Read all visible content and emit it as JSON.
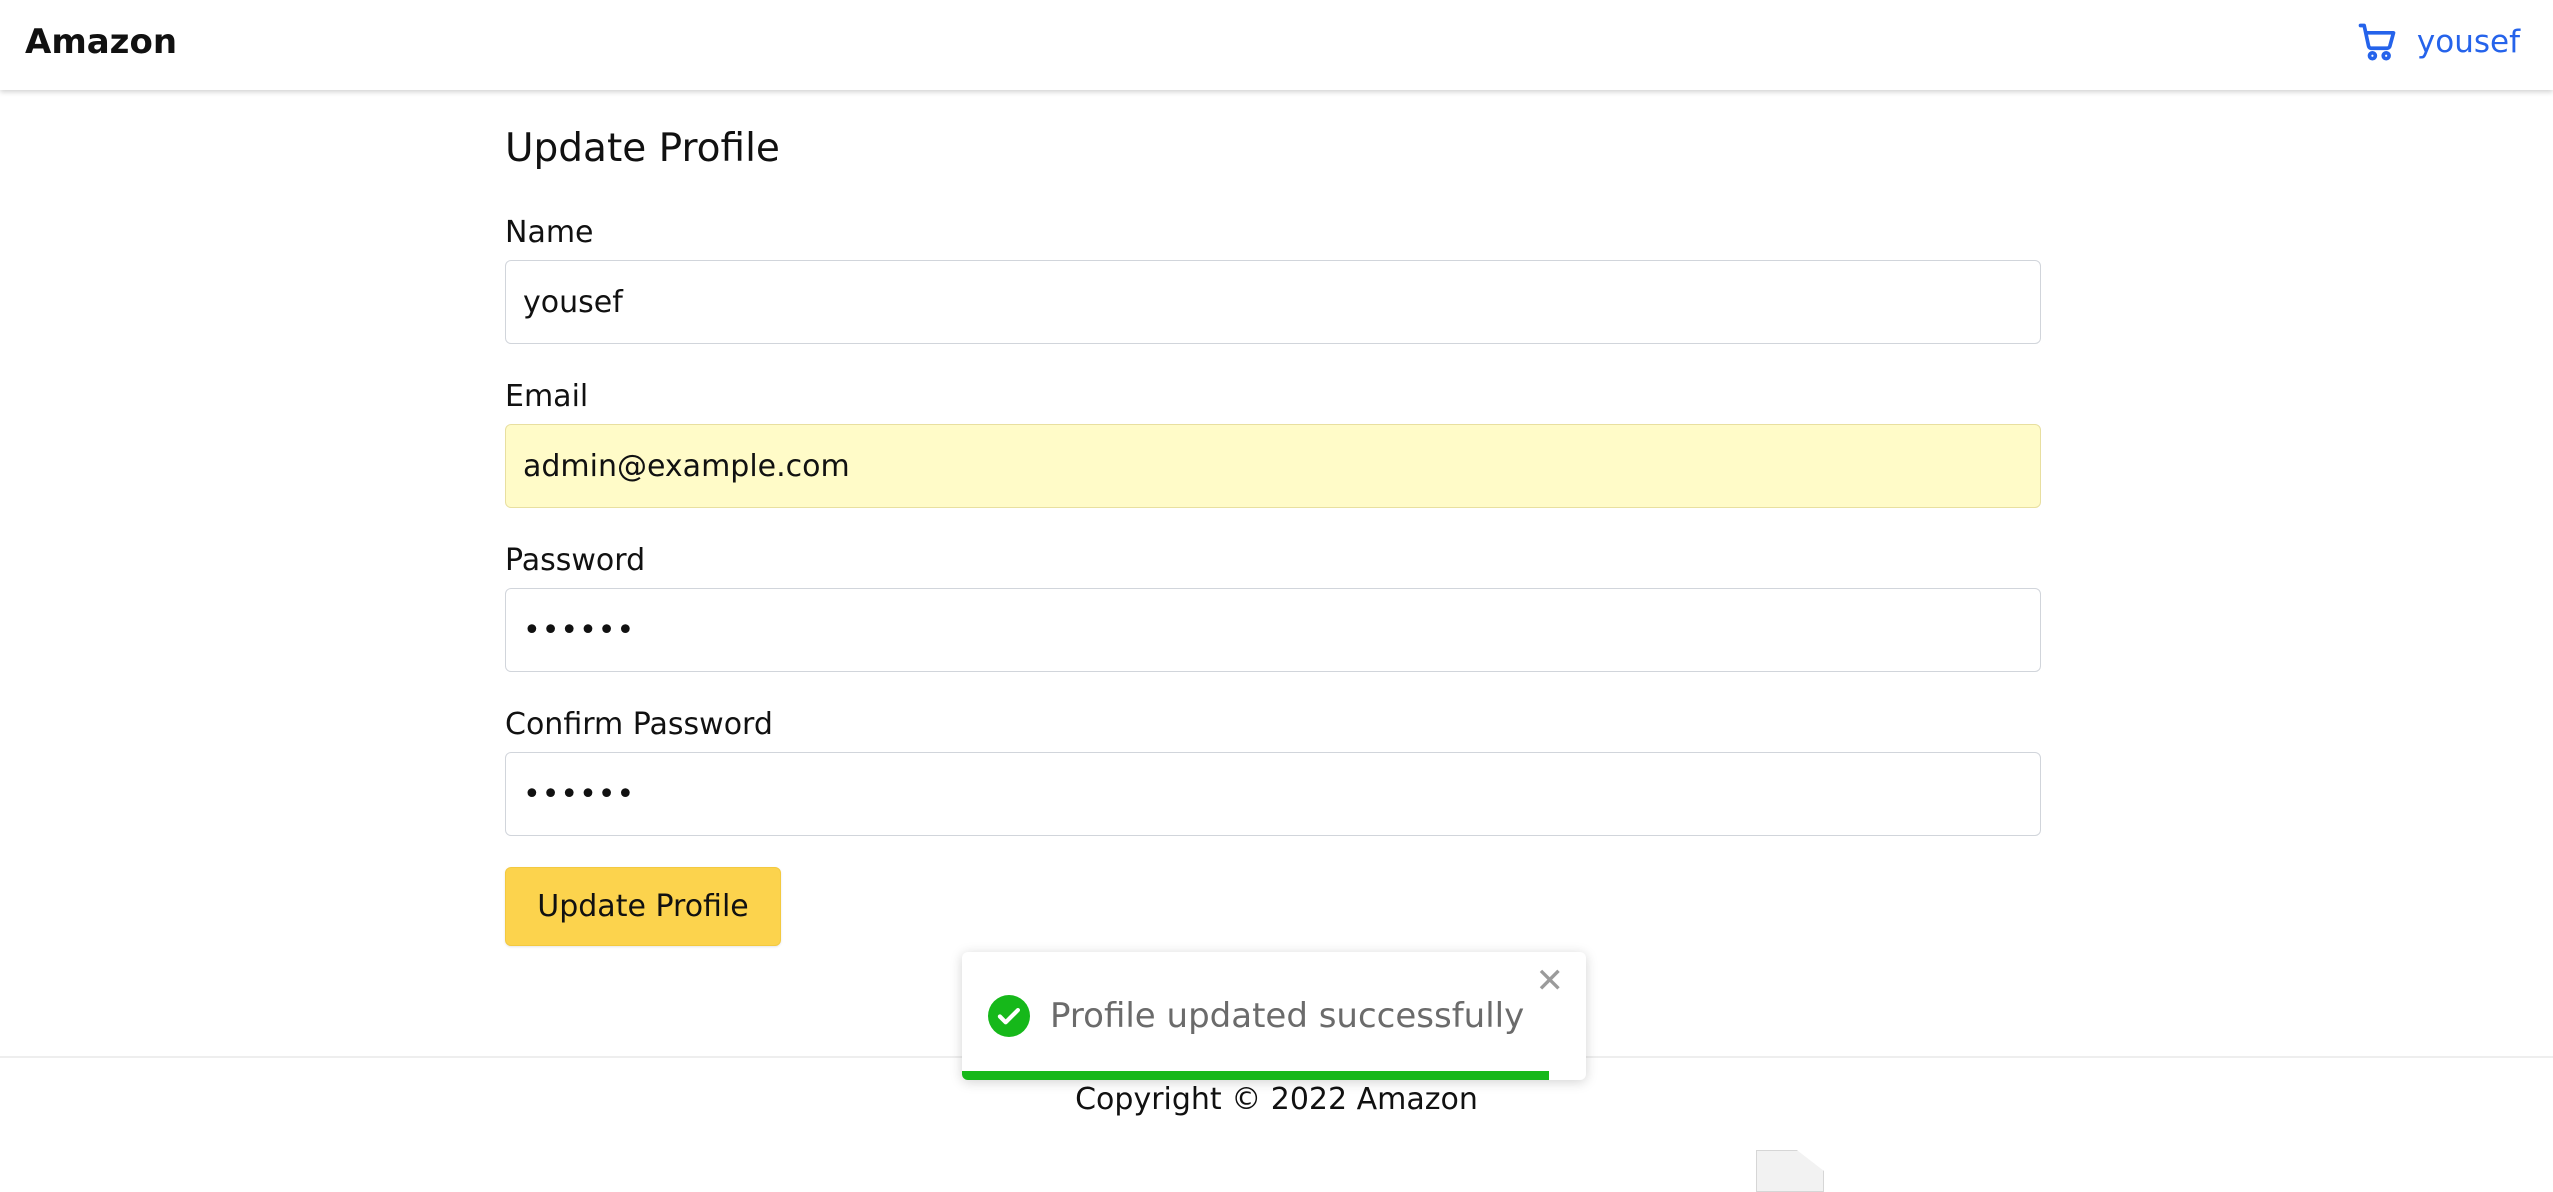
{
  "header": {
    "brand": "Amazon",
    "cart_icon": "cart-icon",
    "username": "yousef",
    "link_color": "#2563eb"
  },
  "form": {
    "title": "Update Profile",
    "name_label": "Name",
    "name_value": "yousef",
    "email_label": "Email",
    "email_value": "admin@example.com",
    "password_label": "Password",
    "password_value": "••••••",
    "confirm_label": "Confirm Password",
    "confirm_value": "••••••",
    "submit_label": "Update Profile",
    "button_color": "#fcd34d"
  },
  "toast": {
    "message": "Profile updated successfully",
    "close": "✕",
    "icon": "check-circle-icon",
    "color": "#16b81a",
    "progress_fraction": 0.94
  },
  "footer": {
    "copyright": "Copyright © 2022 Amazon"
  }
}
